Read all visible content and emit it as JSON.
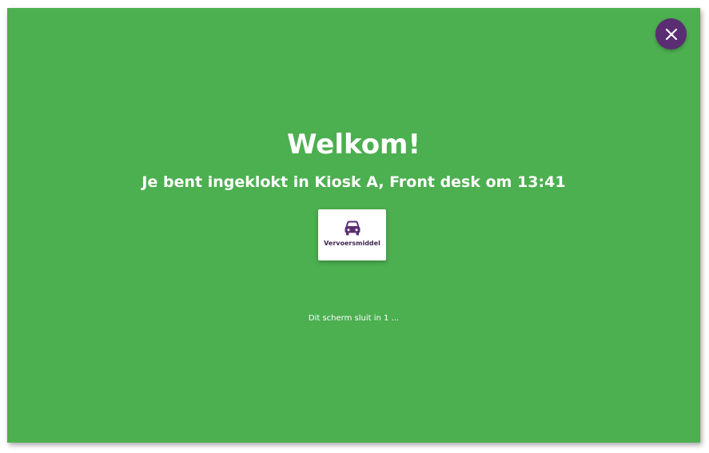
{
  "screen": {
    "background_color": "#4caf50",
    "accent_color": "#5b2d73"
  },
  "close_button": {
    "icon": "close-icon"
  },
  "welcome": {
    "title": "Welkom!",
    "subtitle": "Je bent ingeklokt in Kiosk A, Front desk om 13:41"
  },
  "transport_card": {
    "icon": "car-icon",
    "label": "Vervoersmiddel"
  },
  "countdown": {
    "text": "Dit scherm sluit in 1 ..."
  }
}
